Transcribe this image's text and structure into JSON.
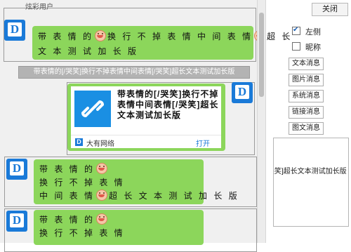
{
  "chat": {
    "group1": {
      "nickname": "炫彩用户",
      "line1_a": "带 表 情 的",
      "line1_b": "换 行 不 掉 表 情 中 间 表 情",
      "line1_c": "超 长",
      "line2": "文 本 测 试 加 长 版"
    },
    "center_note": "带表情的[/哭笑]换行不掉表情中间表情[/哭笑]超长文本测试加长版",
    "link_card": {
      "title": "带表情的[/哭笑]换行不掉表情中间表情[/哭笑]超长文本测试加长版",
      "source": "大有网络",
      "open_label": "打开"
    },
    "message3": {
      "line1": "带 表 情 的",
      "line2": "换 行 不 掉 表 情",
      "line3_a": "中 间 表 情",
      "line3_b": "超 长 文 本 测 试 加 长 版"
    },
    "message4": {
      "line1": "带 表 情 的",
      "line2": "换 行 不 掉 表 情"
    }
  },
  "avatar_letter": "D",
  "panel": {
    "close_label": "关闭",
    "options": [
      {
        "label": "左侧",
        "checked": true
      },
      {
        "label": "昵称",
        "checked": false
      }
    ],
    "buttons": [
      "文本消息",
      "图片消息",
      "系统消息",
      "链接消息",
      "图文消息"
    ],
    "preview_text": "带表情的[/哭笑]换行不掉表情中间表情[/哭笑]超长文本测试加长版"
  },
  "colors": {
    "bubble": "#8cd65b",
    "avatar": "#1a7ad8",
    "link_thumb": "#1a8fe3",
    "note_bg": "#b3b3b3"
  },
  "icons": [
    "avatar-d-icon",
    "smiley-emoji-icon",
    "link-chain-icon",
    "checkmark-icon"
  ]
}
